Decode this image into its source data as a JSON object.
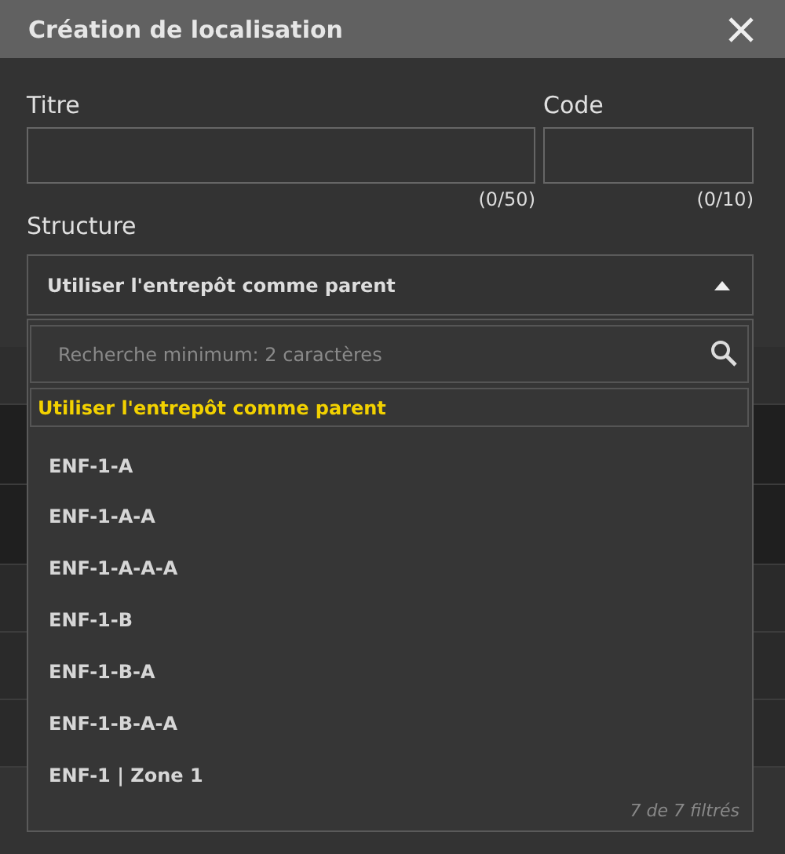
{
  "dialog": {
    "title": "Création de localisation"
  },
  "fields": [
    {
      "label": "Titre",
      "counter": "(0/50)"
    },
    {
      "label": "Code",
      "counter": "(0/10)"
    }
  ],
  "structure": {
    "label": "Structure",
    "value": "Utiliser l'entrepôt comme parent",
    "expanded": true,
    "search": {
      "placeholder": "Recherche minimum: 2 caractères"
    },
    "options": [
      {
        "label": "Utiliser l'entrepôt comme parent",
        "selected": true
      },
      {
        "label": "ENF-1-A",
        "selected": false
      },
      {
        "label": "ENF-1-A-A",
        "selected": false
      },
      {
        "label": "ENF-1-A-A-A",
        "selected": false
      },
      {
        "label": "ENF-1-B",
        "selected": false
      },
      {
        "label": "ENF-1-B-A",
        "selected": false
      },
      {
        "label": "ENF-1-B-A-A",
        "selected": false
      },
      {
        "label": "ENF-1 | Zone 1",
        "selected": false
      }
    ],
    "footer": "7 de 7 filtrés"
  }
}
